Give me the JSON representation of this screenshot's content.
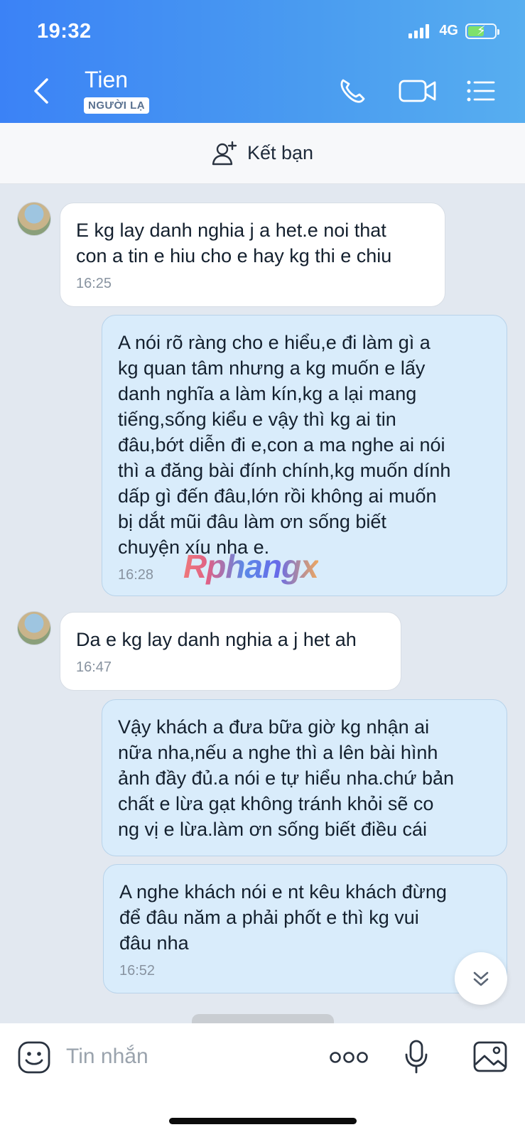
{
  "status_bar": {
    "time": "19:32",
    "network": "4G",
    "battery_level": 0.6
  },
  "header": {
    "contact_name": "Tien",
    "badge": "NGƯỜI LẠ",
    "icons": [
      "back-icon",
      "phone-icon",
      "video-call-icon",
      "menu-list-icon"
    ],
    "background": "#3b82f6"
  },
  "add_friend": {
    "label": "Kết bạn",
    "icon": "add-user-icon"
  },
  "messages": [
    {
      "direction": "in",
      "text": "E kg lay danh nghia j a het.e noi that\ncon a tin e hiu cho e hay kg thi e chiu",
      "time": "16:25"
    },
    {
      "direction": "out",
      "text": "A nói rõ ràng cho e hiểu,e đi làm gì a\nkg quan tâm nhưng a kg muốn e lấy\ndanh nghĩa a làm kín,kg a lại mang\ntiếng,sống kiểu e vậy thì kg ai tin\nđâu,bớt diễn đi e,con a ma nghe ai nói\nthì a đăng bài đính chính,kg muốn dính\ndấp gì đến đâu,lớn rồi không ai muốn\nbị dắt mũi đâu làm ơn sống biết\nchuyện xíu nha e.",
      "time": "16:28"
    },
    {
      "direction": "in",
      "text": "Da e kg lay danh nghia a j het ah",
      "time": "16:47"
    },
    {
      "direction": "out",
      "text": "Vậy khách a đưa bữa giờ kg nhận ai\nnữa nha,nếu a nghe thì a lên bài hình\nảnh đầy đủ.a nói e tự hiểu nha.chứ bản\nchất e lừa gạt không tránh khỏi sẽ co\nng vị e lừa.làm ơn sống biết điều cái",
      "time": ""
    },
    {
      "direction": "out",
      "text": "A nghe khách nói e nt kêu khách đừng\nđể đâu năm a phải phốt e thì kg vui\nđâu nha",
      "time": "16:52"
    }
  ],
  "watermark": "Rphangx",
  "composer": {
    "placeholder": "Tin nhắn",
    "icons": [
      "sticker-icon",
      "more-icon",
      "microphone-icon",
      "image-icon"
    ]
  },
  "scroll_down_icon": "double-chevron-down-icon"
}
